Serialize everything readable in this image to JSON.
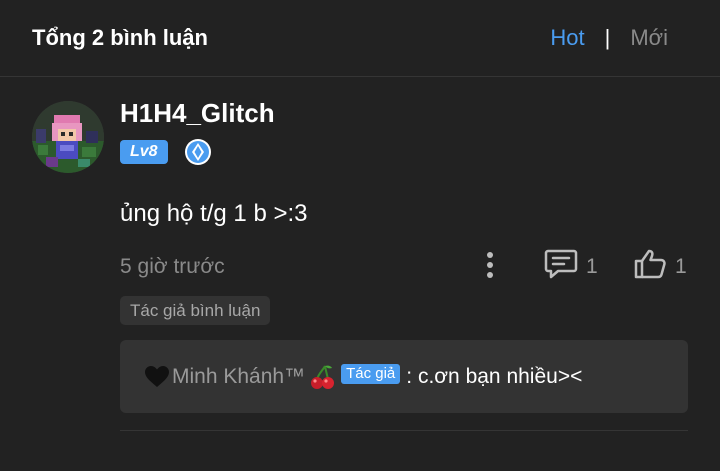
{
  "header": {
    "title": "Tổng 2 bình luận",
    "sort_hot": "Hot",
    "sort_separator": "|",
    "sort_new": "Mới"
  },
  "comment": {
    "username": "H1H4_Glitch",
    "level": "Lv8",
    "text": "ủng hộ t/g 1 b >:3",
    "timestamp": "5 giờ trước",
    "reply_count": "1",
    "like_count": "1",
    "author_tag": "Tác giả bình luận"
  },
  "reply": {
    "name": "Minh Khánh™",
    "author_badge": "Tác giả",
    "content": ": c.ơn bạn nhiều><"
  },
  "icons": {
    "more": "more-vertical-icon",
    "reply": "comment-icon",
    "like": "thumbs-up-icon",
    "rank": "diamond-rank-icon",
    "heart": "black-heart-icon",
    "cherry": "cherry-icon"
  },
  "colors": {
    "background": "#222222",
    "accent": "#4a9cf0",
    "muted": "#8a8a8a",
    "panel": "#333333"
  }
}
